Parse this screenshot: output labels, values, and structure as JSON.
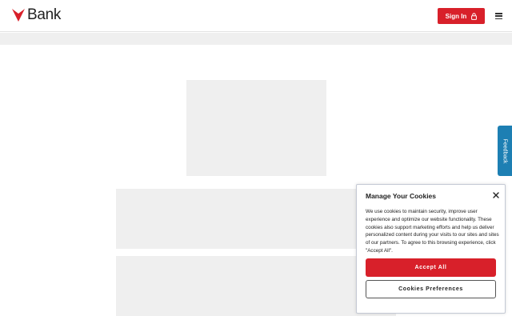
{
  "header": {
    "logo_text": "Bank",
    "signin_label": "Sign In",
    "brand_color": "#d8202a",
    "icons": {
      "logo": "maple-leaf-icon",
      "signin": "lock-icon",
      "menu": "hamburger-menu-icon"
    }
  },
  "feedback": {
    "label": "Feedback",
    "color": "#1d7fb3"
  },
  "cookie_dialog": {
    "title": "Manage Your Cookies",
    "body": "We use cookies to maintain security, improve user experience and optimize our website functionality. These cookies also support marketing efforts and help us deliver personalized content during your visits to our sites and sites of our partners. To agree to this browsing experience, click \"Accept All\".",
    "accept_label": "Accept All",
    "preferences_label": "Cookies Preferences",
    "close_icon": "close-icon"
  }
}
